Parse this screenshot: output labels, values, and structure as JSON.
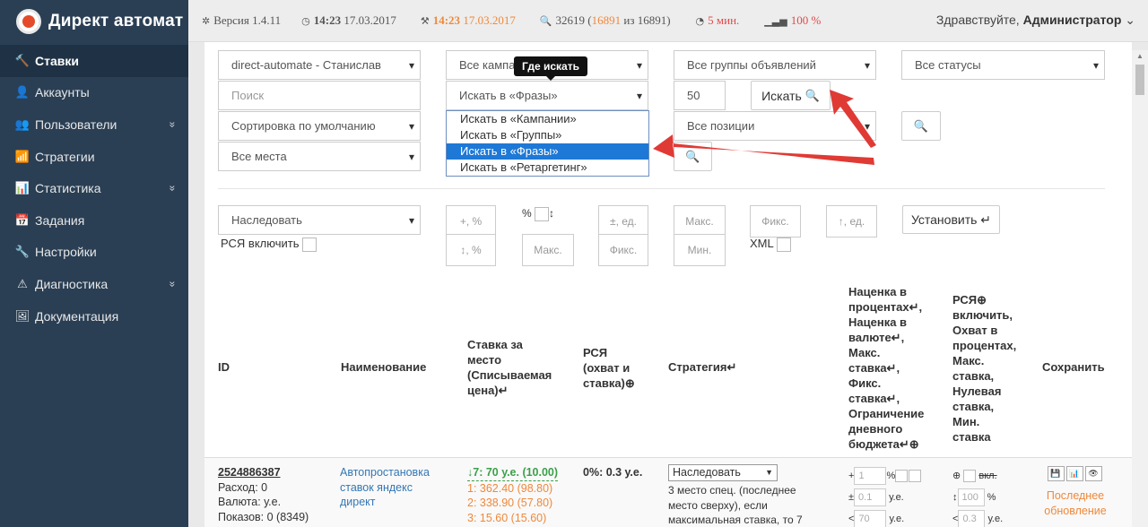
{
  "app": {
    "title": "Директ автомат"
  },
  "sidebar": {
    "items": [
      {
        "label": "Ставки",
        "icon": "wrench-icon",
        "glyph": "🔨",
        "active": true
      },
      {
        "label": "Аккаунты",
        "icon": "user-icon",
        "glyph": "👤"
      },
      {
        "label": "Пользователи",
        "icon": "users-icon",
        "glyph": "👥",
        "chevron": "»"
      },
      {
        "label": "Стратегии",
        "icon": "signal-icon",
        "glyph": "📶"
      },
      {
        "label": "Статистика",
        "icon": "bar-chart-icon",
        "glyph": "📊",
        "chevron": "»"
      },
      {
        "label": "Задания",
        "icon": "calendar-icon",
        "glyph": "📅"
      },
      {
        "label": "Настройки",
        "icon": "wrench-icon",
        "glyph": "🔧"
      },
      {
        "label": "Диагностика",
        "icon": "warning-icon",
        "glyph": "⚠",
        "chevron": "»"
      },
      {
        "label": "Документация",
        "icon": "picture-icon",
        "glyph": "🖼"
      }
    ]
  },
  "topbar": {
    "version": "Версия 1.4.11",
    "time1": "14:23",
    "date1": "17.03.2017",
    "time2": "14:23",
    "date2": "17.03.2017",
    "count_total": "32619",
    "count_a": "16891",
    "count_of": "из",
    "count_b": "16891",
    "minutes": "5 мин.",
    "percent": "100 %",
    "greeting": "Здравствуйте,",
    "user": "Администратор"
  },
  "filters": {
    "account": "direct-automate - Станислав",
    "campaigns": "Все кампании",
    "groups": "Все группы объявлений",
    "statuses": "Все статусы",
    "search_placeholder": "Поиск",
    "search_in": "Искать в «Фразы»",
    "limit": "50",
    "search_button": "Искать",
    "sort": "Сортировка по умолчанию",
    "positions": "Все позиции",
    "places": "Все места",
    "tooltip": "Где искать",
    "dropdown": [
      "Искать в «Кампании»",
      "Искать в «Группы»",
      "Искать в «Фразы»",
      "Искать в «Ретаргетинг»"
    ],
    "dropdown_selected": 2
  },
  "bulk": {
    "inherit": "Наследовать",
    "rsya_enable": "РСЯ включить",
    "plus_pct": "+, %",
    "updown_pct": "↕, %",
    "pct_label": "%",
    "max1": "Макс.",
    "pm_unit": "±, ед.",
    "fix1": "Фикс.",
    "max2": "Макс.",
    "min": "Мин.",
    "fix2": "Фикс.",
    "xml": "XML",
    "up_unit": "↑, ед.",
    "set_button": "Установить ↵"
  },
  "table": {
    "headers": {
      "id": "ID",
      "name": "Наименование",
      "bid": [
        "Ставка за",
        "место",
        "(Списываемая",
        "цена)↵"
      ],
      "rsya": [
        "РСЯ",
        "(охват и",
        "ставка)⊕"
      ],
      "strategy": "Стратегия↵",
      "markup": [
        "Наценка в",
        "процентах↵,",
        "Наценка в",
        "валюте↵,",
        "Макс.",
        "ставка↵,",
        "Фикс.",
        "ставка↵,",
        "Ограничение",
        "дневного",
        "бюджета↵⊕"
      ],
      "rsya2": [
        "РСЯ⊕",
        "включить,",
        "Охват в",
        "процентах,",
        "Макс.",
        "ставка,",
        "Нулевая",
        "ставка,",
        "Мин.",
        "ставка"
      ],
      "save": "Сохранить"
    },
    "row": {
      "id": "2524886387",
      "spend": "Расход: 0",
      "currency": "Валюта: у.е.",
      "shows": "Показов: 0 (8349)",
      "name": [
        "Автопростановка",
        "ставок яндекс",
        "директ"
      ],
      "bid_main": "↓7: 70 у.е. (10.00)",
      "bids": [
        "1: 362.40 (98.80)",
        "2: 338.90 (57.80)",
        "3: 15.60 (15.60)"
      ],
      "rsya": "0%: 0.3 у.е.",
      "strategy_select": "Наследовать",
      "strategy_text": [
        "3 место спец. (последнее",
        "место сверху), если",
        "максимальная ставка, то 7"
      ],
      "mk_plus": "+",
      "mk_plus_val": "1",
      "mk_pct": "%",
      "mk_pm": "±",
      "mk_pm_val": "0.1",
      "mk_unit1": "у.е.",
      "mk_lt": "<",
      "mk_lt_val": "70",
      "mk_unit2": "у.е.",
      "r2_off": "вкл.",
      "r2_val1": "100",
      "r2_pct": "%",
      "r2_lt": "<",
      "r2_val2": "0.3",
      "r2_unit": "у.е.",
      "last_update": [
        "Последнее",
        "обновление"
      ]
    }
  },
  "colors": {
    "sidebar": "#2a3f54",
    "accent": "#1e78d6",
    "arrow": "#e03a35",
    "orange": "#f0883a",
    "link": "#3377b5",
    "green": "#3ba04a"
  }
}
